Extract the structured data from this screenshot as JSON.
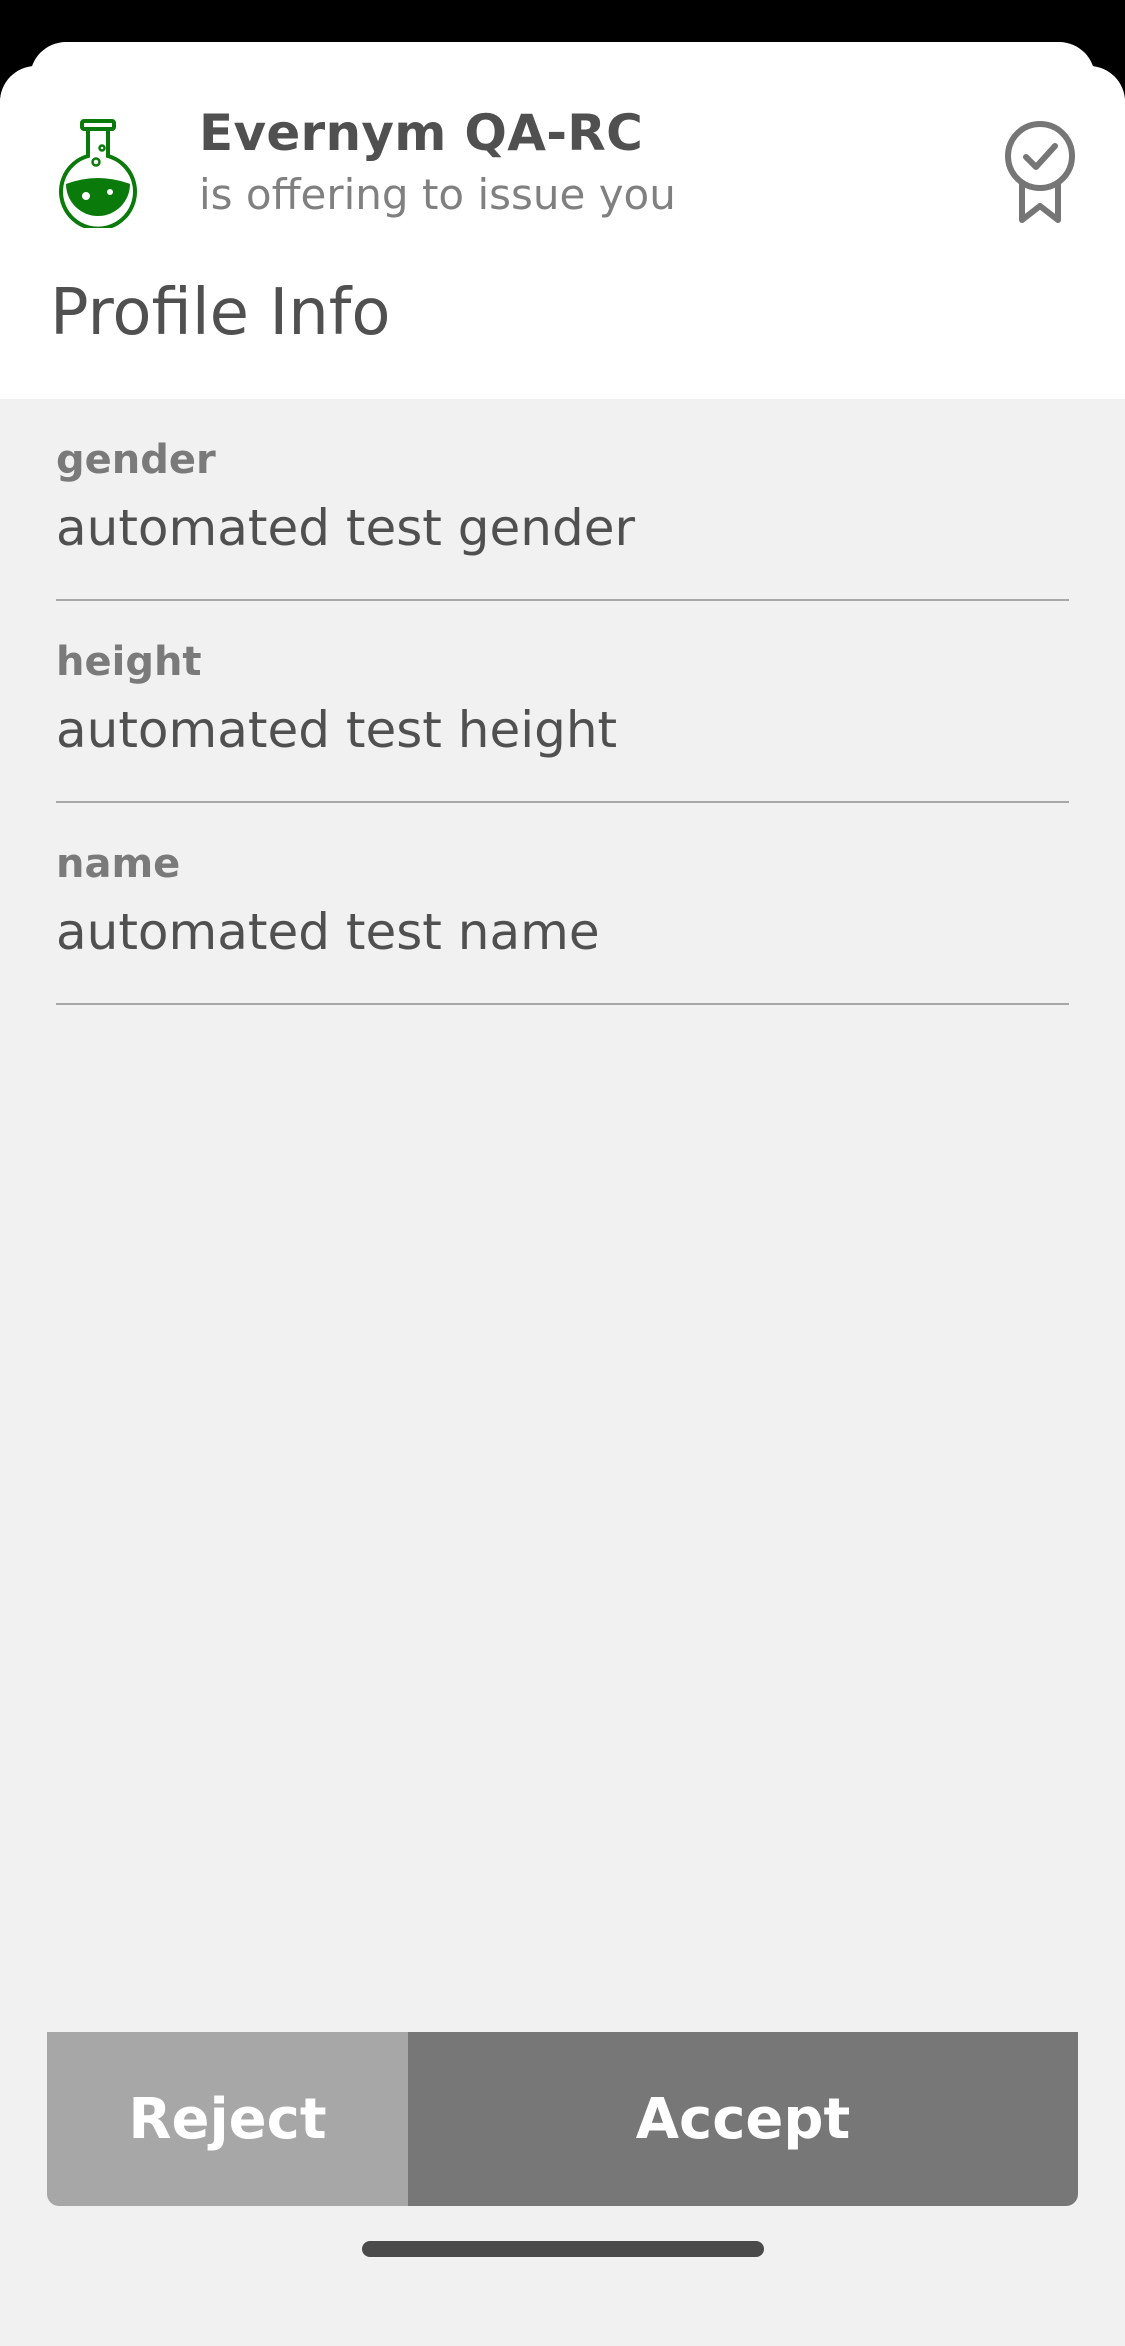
{
  "issuer": {
    "name": "Evernym QA-RC",
    "subtitle": "is offering to issue you",
    "logo_icon": "flask-icon",
    "logo_color": "#0a7a0a"
  },
  "credential": {
    "title": "Profile Info",
    "badge_icon": "award-ribbon-check-icon",
    "attributes": [
      {
        "label": "gender",
        "value": "automated test gender"
      },
      {
        "label": "height",
        "value": "automated test height"
      },
      {
        "label": "name",
        "value": "automated test name"
      }
    ]
  },
  "actions": {
    "reject_label": "Reject",
    "accept_label": "Accept"
  },
  "colors": {
    "reject_bg": "#a7a7a7",
    "accept_bg": "#777777",
    "sheet_bg": "#f1f1f1",
    "header_bg": "#ffffff"
  }
}
